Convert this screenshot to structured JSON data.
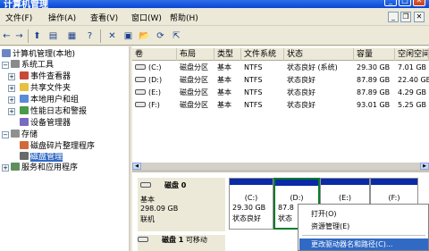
{
  "window": {
    "title": "计算机管理",
    "min": "_",
    "max": "□",
    "close": "✕"
  },
  "menu": [
    {
      "label": "文件(F)"
    },
    {
      "label": "操作(A)"
    },
    {
      "label": "查看(V)"
    },
    {
      "label": "窗口(W)"
    },
    {
      "label": "帮助(H)"
    }
  ],
  "mdi": {
    "min": "_",
    "restore": "❐",
    "close": "✕"
  },
  "toolbar": {
    "icons": [
      "back-arrow-icon",
      "forward-arrow-icon",
      "up-folder-icon",
      "show-tree-icon",
      "properties-icon",
      "help-icon",
      "delete-icon",
      "new-window-icon",
      "open-folder-icon",
      "refresh-icon",
      "export-icon"
    ],
    "glyphs": [
      "←",
      "→",
      "⬆",
      "▤",
      "▦",
      "?",
      "✕",
      "▣",
      "📂",
      "⟳",
      "⇱"
    ]
  },
  "tree": {
    "root": "计算机管理(本地)",
    "system_tools": "系统工具",
    "event_viewer": "事件查看器",
    "shared_folders": "共享文件夹",
    "local_users": "本地用户和组",
    "perf_logs": "性能日志和警报",
    "device_manager": "设备管理器",
    "storage": "存储",
    "defrag": "磁盘碎片整理程序",
    "disk_mgmt": "磁盘管理",
    "services": "服务和应用程序"
  },
  "columns": [
    "卷",
    "布局",
    "类型",
    "文件系统",
    "状态",
    "容量",
    "空闲空间"
  ],
  "volumes": [
    {
      "vol": "(C:)",
      "layout": "磁盘分区",
      "type": "基本",
      "fs": "NTFS",
      "status": "状态良好 (系统)",
      "capacity": "29.30 GB",
      "free": "7.01 GB"
    },
    {
      "vol": "(D:)",
      "layout": "磁盘分区",
      "type": "基本",
      "fs": "NTFS",
      "status": "状态良好",
      "capacity": "87.89 GB",
      "free": "22.40 GB"
    },
    {
      "vol": "(E:)",
      "layout": "磁盘分区",
      "type": "基本",
      "fs": "NTFS",
      "status": "状态良好",
      "capacity": "87.89 GB",
      "free": "4.29 GB"
    },
    {
      "vol": "(F:)",
      "layout": "磁盘分区",
      "type": "基本",
      "fs": "NTFS",
      "status": "状态良好",
      "capacity": "93.01 GB",
      "free": "5.25 GB"
    }
  ],
  "disk0": {
    "name": "磁盘 0",
    "type": "基本",
    "size": "298.09 GB",
    "state": "联机",
    "parts": [
      {
        "label": "(C:)",
        "size": "29.30 GB",
        "state": "状态良好"
      },
      {
        "label": "(D:)",
        "size": "87.8",
        "state": "状态"
      },
      {
        "label": "(E:)"
      },
      {
        "label": "(F:)"
      }
    ]
  },
  "disk1": {
    "name": "磁盘 1",
    "sub": "可移动"
  },
  "context_menu": {
    "open": "打开(O)",
    "explore": "资源管理(E)",
    "change_letter": "更改驱动器名和路径(C)..."
  },
  "colors": {
    "title_bar": "#0a46d6",
    "partition_bar": "#0a2aa8",
    "selection": "#316ac5",
    "selected_partition_border": "#0c7a2c"
  }
}
